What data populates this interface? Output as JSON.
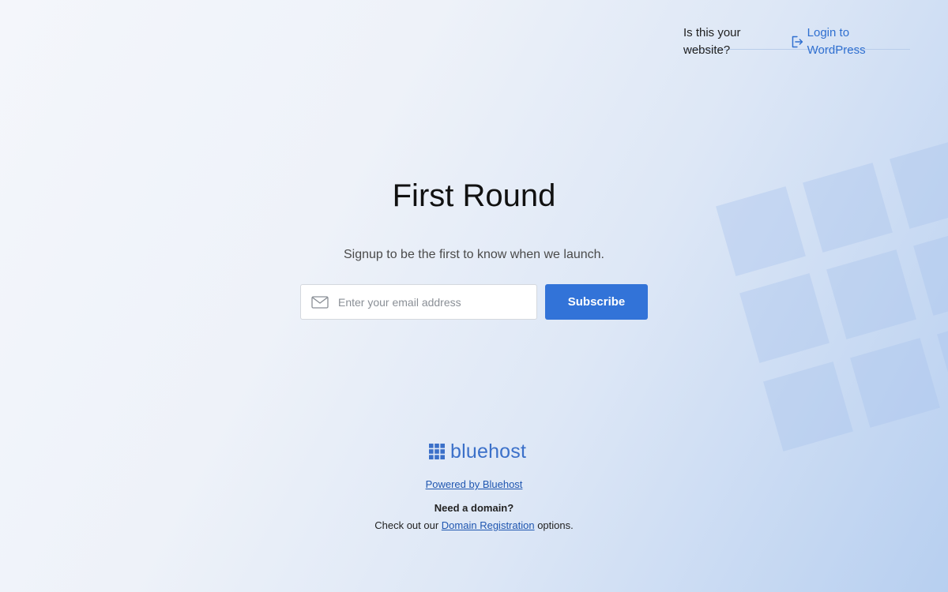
{
  "header": {
    "question": "Is this your website?",
    "login_label": "Login to WordPress",
    "login_icon": "login-icon"
  },
  "main": {
    "title": "First Round",
    "subtitle": "Signup to be the first to know when we launch.",
    "email_placeholder": "Enter your email address",
    "email_value": "",
    "email_icon": "mail-icon",
    "subscribe_label": "Subscribe"
  },
  "footer": {
    "brand_name": "bluehost",
    "powered_label": "Powered by Bluehost",
    "need_domain": "Need a domain?",
    "check_prefix": "Check out our",
    "domain_link": "Domain Registration",
    "check_suffix": "options."
  },
  "colors": {
    "accent": "#3273d8",
    "link": "#1f56b0",
    "brand": "#3b70c9"
  }
}
